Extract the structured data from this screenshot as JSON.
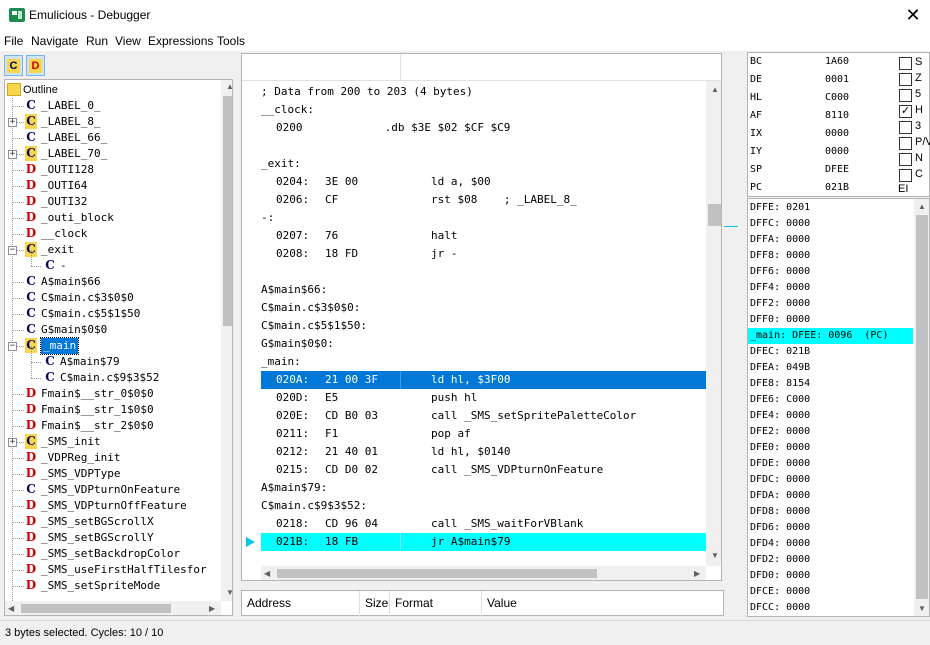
{
  "window": {
    "title": "Emulicious - Debugger",
    "close_symbol": "✕"
  },
  "menu": [
    "File",
    "Navigate",
    "Run",
    "View",
    "Expressions",
    "Tools"
  ],
  "toolbar": {
    "c_label": "C",
    "d_label": "D"
  },
  "outline": {
    "root": "Outline",
    "items": [
      {
        "kind": "C",
        "label": "_LABEL_0_",
        "hl": false
      },
      {
        "kind": "C",
        "label": "_LABEL_8_",
        "hl": true
      },
      {
        "kind": "C",
        "label": "_LABEL_66_",
        "hl": false
      },
      {
        "kind": "C",
        "label": "_LABEL_70_",
        "hl": true
      },
      {
        "kind": "D",
        "label": "_OUTI128",
        "hl": false
      },
      {
        "kind": "D",
        "label": "_OUTI64",
        "hl": false
      },
      {
        "kind": "D",
        "label": "_OUTI32",
        "hl": false
      },
      {
        "kind": "D",
        "label": "_outi_block",
        "hl": false
      },
      {
        "kind": "D",
        "label": "__clock",
        "hl": false
      },
      {
        "kind": "C",
        "label": "_exit",
        "hl": true
      },
      {
        "kind": "C",
        "label": "-",
        "hl": false
      },
      {
        "kind": "C",
        "label": "A$main$66",
        "hl": false
      },
      {
        "kind": "C",
        "label": "C$main.c$3$0$0",
        "hl": false
      },
      {
        "kind": "C",
        "label": "C$main.c$5$1$50",
        "hl": false
      },
      {
        "kind": "C",
        "label": "G$main$0$0",
        "hl": false
      },
      {
        "kind": "C",
        "label": "_main",
        "hl": true
      },
      {
        "kind": "C",
        "label": "A$main$79",
        "hl": false
      },
      {
        "kind": "C",
        "label": "C$main.c$9$3$52",
        "hl": false
      },
      {
        "kind": "D",
        "label": "Fmain$__str_0$0$0",
        "hl": false
      },
      {
        "kind": "D",
        "label": "Fmain$__str_1$0$0",
        "hl": false
      },
      {
        "kind": "D",
        "label": "Fmain$__str_2$0$0",
        "hl": false
      },
      {
        "kind": "C",
        "label": "_SMS_init",
        "hl": true
      },
      {
        "kind": "D",
        "label": "_VDPReg_init",
        "hl": false
      },
      {
        "kind": "D",
        "label": "_SMS_VDPType",
        "hl": false
      },
      {
        "kind": "C",
        "label": "_SMS_VDPturnOnFeature",
        "hl": false
      },
      {
        "kind": "D",
        "label": "_SMS_VDPturnOffFeature",
        "hl": false
      },
      {
        "kind": "D",
        "label": "_SMS_setBGScrollX",
        "hl": false
      },
      {
        "kind": "D",
        "label": "_SMS_setBGScrollY",
        "hl": false
      },
      {
        "kind": "D",
        "label": "_SMS_setBackdropColor",
        "hl": false
      },
      {
        "kind": "D",
        "label": "_SMS_useFirstHalfTilesfor",
        "hl": false
      },
      {
        "kind": "D",
        "label": "_SMS_setSpriteMode",
        "hl": false
      }
    ]
  },
  "code": {
    "lines": [
      {
        "raw": "; Data from 200 to 203 (4 bytes)"
      },
      {
        "raw": "__clock:"
      },
      {
        "addr": "0200",
        "bytes": "",
        "instr": "         .db $3E $02 $CF $C9"
      },
      {
        "raw": ""
      },
      {
        "raw": "_exit:"
      },
      {
        "addr": "0204:",
        "bytes": "3E 00",
        "instr": "ld a, $00"
      },
      {
        "addr": "0206:",
        "bytes": "CF",
        "instr": "rst $08    ; _LABEL_8_"
      },
      {
        "raw": "-:"
      },
      {
        "addr": "0207:",
        "bytes": "76",
        "instr": "halt"
      },
      {
        "addr": "0208:",
        "bytes": "18 FD",
        "instr": "jr -"
      },
      {
        "raw": ""
      },
      {
        "raw": "A$main$66:"
      },
      {
        "raw": "C$main.c$3$0$0:"
      },
      {
        "raw": "C$main.c$5$1$50:"
      },
      {
        "raw": "G$main$0$0:"
      },
      {
        "raw": "_main:"
      },
      {
        "addr": "020A:",
        "bytes": "21 00 3F",
        "instr": "ld hl, $3F00",
        "state": "selected"
      },
      {
        "addr": "020D:",
        "bytes": "E5",
        "instr": "push hl"
      },
      {
        "addr": "020E:",
        "bytes": "CD B0 03",
        "instr": "call _SMS_setSpritePaletteColor"
      },
      {
        "addr": "0211:",
        "bytes": "F1",
        "instr": "pop af"
      },
      {
        "addr": "0212:",
        "bytes": "21 40 01",
        "instr": "ld hl, $0140"
      },
      {
        "addr": "0215:",
        "bytes": "CD D0 02",
        "instr": "call _SMS_VDPturnOnFeature"
      },
      {
        "raw": "A$main$79:"
      },
      {
        "raw": "C$main.c$9$3$52:"
      },
      {
        "addr": "0218:",
        "bytes": "CD 96 04",
        "instr": "call _SMS_waitForVBlank"
      },
      {
        "addr": "021B:",
        "bytes": "18 FB",
        "instr": "jr A$main$79",
        "state": "pc"
      }
    ]
  },
  "watch": {
    "columns": [
      "Address",
      "Size",
      "Format",
      "Value"
    ]
  },
  "registers": [
    {
      "name": "BC",
      "value": "1A60"
    },
    {
      "name": "DE",
      "value": "0001"
    },
    {
      "name": "HL",
      "value": "C000"
    },
    {
      "name": "AF",
      "value": "8110"
    },
    {
      "name": "IX",
      "value": "0000"
    },
    {
      "name": "IY",
      "value": "0000"
    },
    {
      "name": "SP",
      "value": "DFEE"
    },
    {
      "name": "PC",
      "value": "021B"
    }
  ],
  "flags": [
    {
      "name": "S",
      "checked": false
    },
    {
      "name": "Z",
      "checked": false
    },
    {
      "name": "5",
      "checked": false
    },
    {
      "name": "H",
      "checked": true
    },
    {
      "name": "3",
      "checked": false
    },
    {
      "name": "P/V",
      "checked": false
    },
    {
      "name": "N",
      "checked": false
    },
    {
      "name": "C",
      "checked": false
    }
  ],
  "ei_label": "EI",
  "stack": [
    {
      "text": "DFFE: 0201"
    },
    {
      "text": "DFFC: 0000"
    },
    {
      "text": "DFFA: 0000"
    },
    {
      "text": "DFF8: 0000"
    },
    {
      "text": "DFF6: 0000"
    },
    {
      "text": "DFF4: 0000"
    },
    {
      "text": "DFF2: 0000"
    },
    {
      "text": "DFF0: 0000"
    },
    {
      "text": "_main: DFEE: 0096  (PC)",
      "sp": true
    },
    {
      "text": "DFEC: 021B"
    },
    {
      "text": "DFEA: 049B"
    },
    {
      "text": "DFE8: 8154"
    },
    {
      "text": "DFE6: C000"
    },
    {
      "text": "DFE4: 0000"
    },
    {
      "text": "DFE2: 0000"
    },
    {
      "text": "DFE0: 0000"
    },
    {
      "text": "DFDE: 0000"
    },
    {
      "text": "DFDC: 0000"
    },
    {
      "text": "DFDA: 0000"
    },
    {
      "text": "DFD8: 0000"
    },
    {
      "text": "DFD6: 0000"
    },
    {
      "text": "DFD4: 0000"
    },
    {
      "text": "DFD2: 0000"
    },
    {
      "text": "DFD0: 0000"
    },
    {
      "text": "DFCE: 0000"
    },
    {
      "text": "DFCC: 0000"
    }
  ],
  "status": "3 bytes selected. Cycles: 10 / 10"
}
